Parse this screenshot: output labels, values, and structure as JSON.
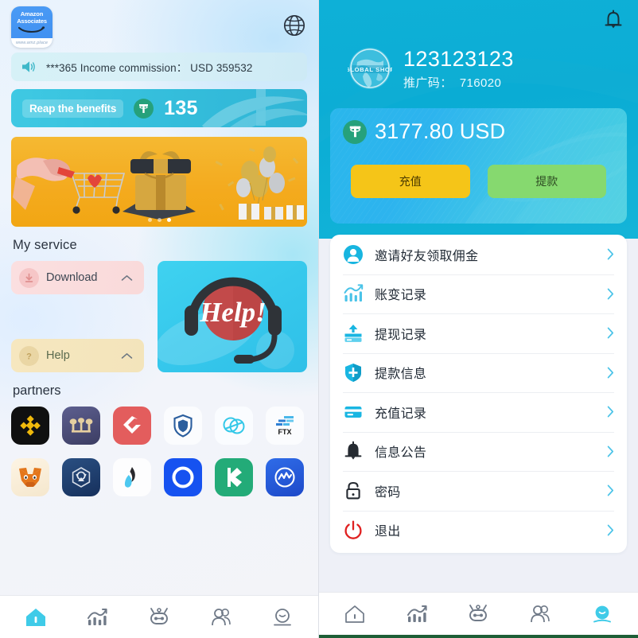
{
  "left": {
    "logo": {
      "line1": "Amazon",
      "line2": "Associates",
      "url": "www.amz.place",
      "icon": "amazon-smile-icon"
    },
    "language_icon": "globe-icon",
    "notice": {
      "icon": "speaker-icon",
      "text": "***365 Income commission： USD 359532"
    },
    "benefit": {
      "label": "Reap the benefits",
      "coin_icon": "usdt-icon",
      "value": "135"
    },
    "banner": {
      "alt": "gift-promo-banner",
      "dots": 3,
      "active_dot": 3
    },
    "service_title": "My service",
    "service_cards": [
      {
        "label": "Download",
        "icon": "download-icon",
        "chevron": "chevron-up-icon"
      },
      {
        "label": "Help",
        "icon": "question-icon",
        "chevron": "chevron-up-icon"
      }
    ],
    "help_card": {
      "text": "Help!",
      "icon": "headset-icon"
    },
    "partners_title": "partners",
    "partners": [
      {
        "name": "binance"
      },
      {
        "name": "polkadot"
      },
      {
        "name": "gate-io"
      },
      {
        "name": "shield"
      },
      {
        "name": "bitfinex"
      },
      {
        "name": "ftx",
        "label": "FTX"
      },
      {
        "name": "metamask"
      },
      {
        "name": "crypto-com"
      },
      {
        "name": "huobi"
      },
      {
        "name": "coinbase"
      },
      {
        "name": "kucoin"
      },
      {
        "name": "coinmarketcap"
      }
    ],
    "nav": [
      {
        "name": "home",
        "active": true
      },
      {
        "name": "chart",
        "active": false
      },
      {
        "name": "robot",
        "active": false
      },
      {
        "name": "team",
        "active": false
      },
      {
        "name": "profile",
        "active": false
      }
    ]
  },
  "right": {
    "bell_icon": "bell-icon",
    "logo_text": "GLOBAL SHOP",
    "account_name": "123123123",
    "promo_code_label": "推广码：",
    "promo_code_value": "716020",
    "balance": {
      "coin_icon": "usdt-icon",
      "amount": "3177.80 USD",
      "recharge_label": "充值",
      "withdraw_label": "提款"
    },
    "menu": [
      {
        "label": "邀请好友领取佣金",
        "icon": "user-circle-icon"
      },
      {
        "label": "账变记录",
        "icon": "chart-icon"
      },
      {
        "label": "提现记录",
        "icon": "card-upload-icon"
      },
      {
        "label": "提款信息",
        "icon": "shield-icon"
      },
      {
        "label": "充值记录",
        "icon": "card-icon"
      },
      {
        "label": "信息公告",
        "icon": "bell-icon"
      },
      {
        "label": "密码",
        "icon": "lock-icon"
      },
      {
        "label": "退出",
        "icon": "power-icon"
      }
    ],
    "nav": [
      {
        "name": "home",
        "active": false
      },
      {
        "name": "chart",
        "active": false
      },
      {
        "name": "robot",
        "active": false
      },
      {
        "name": "team",
        "active": false
      },
      {
        "name": "profile",
        "active": true
      }
    ]
  },
  "colors": {
    "cyan": "#0cafd6",
    "tether_green": "#26a17b",
    "recharge_yellow": "#f5c518",
    "withdraw_green": "#86d96f",
    "logout_red": "#e02020",
    "nav_active": "#3fcbe8",
    "nav_inactive": "#707a88"
  }
}
